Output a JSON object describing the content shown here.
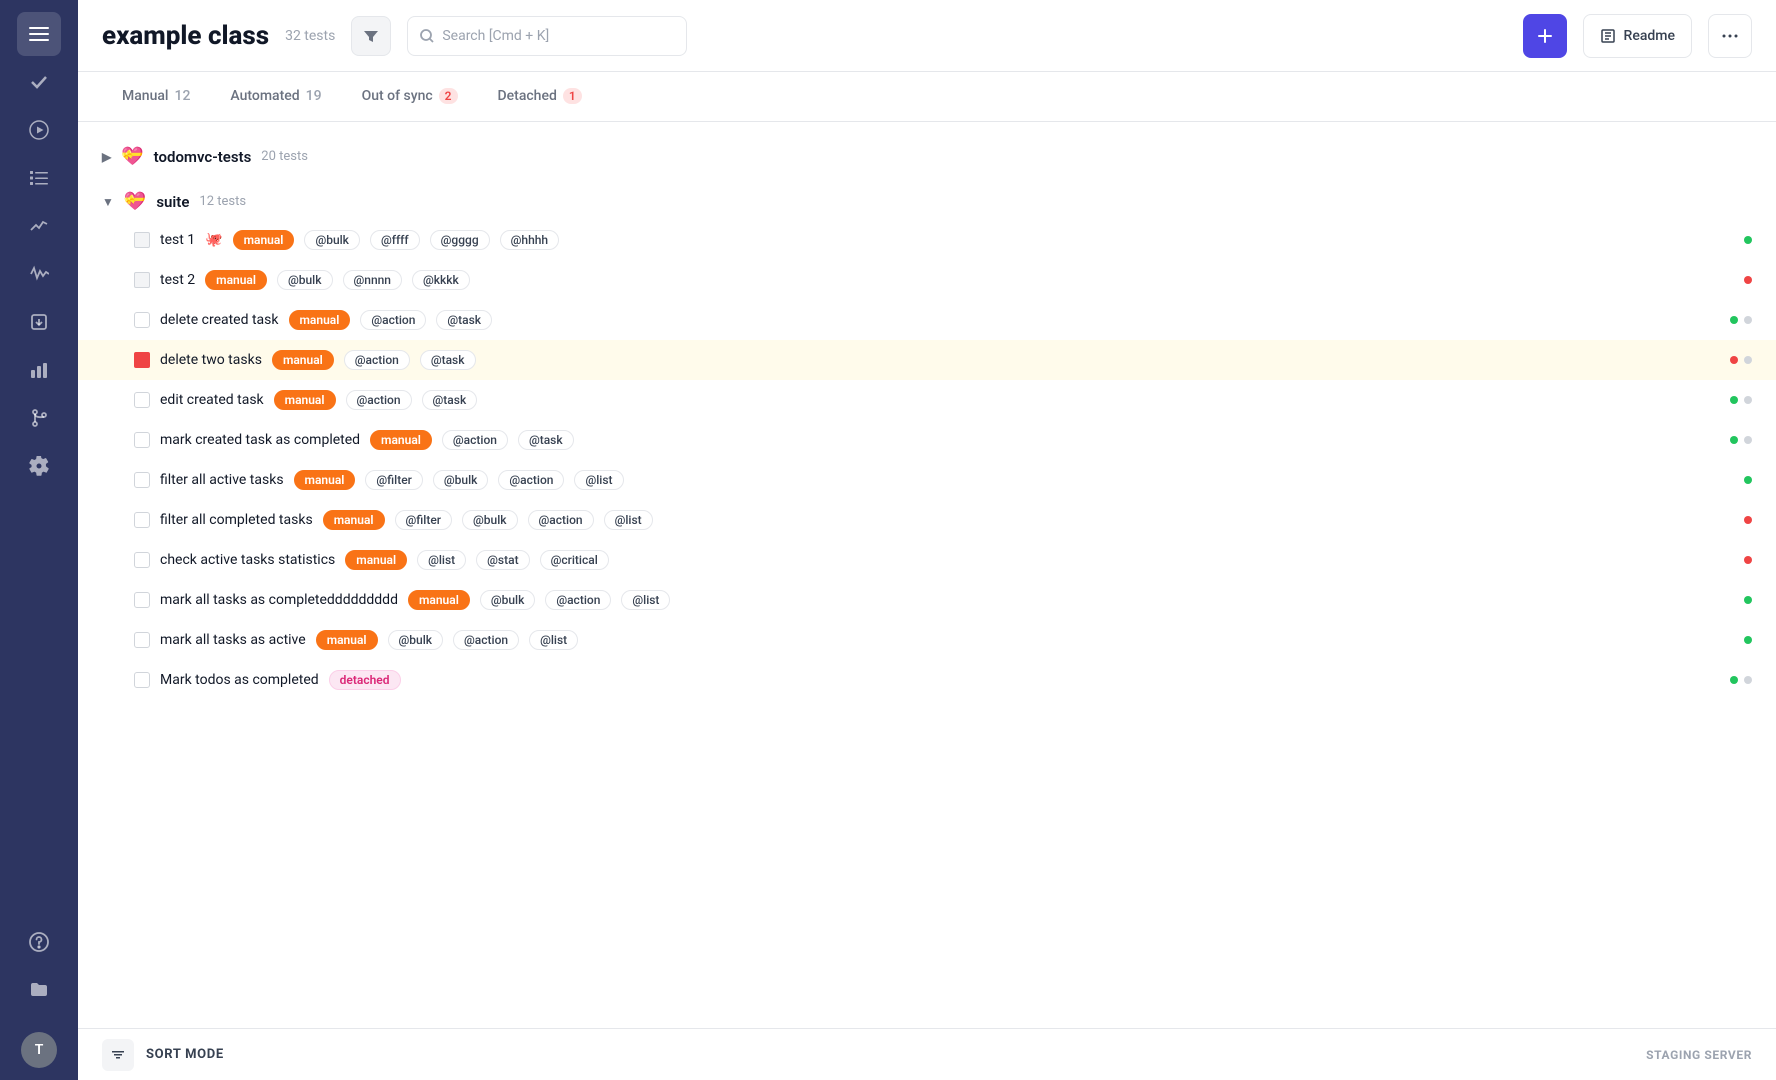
{
  "app": {
    "title": "example class",
    "test_count": "32 tests"
  },
  "sidebar": {
    "items": [
      {
        "name": "hamburger-menu-icon",
        "icon": "☰",
        "active": true
      },
      {
        "name": "check-icon",
        "icon": "✓",
        "active": false
      },
      {
        "name": "play-icon",
        "icon": "▶",
        "active": false
      },
      {
        "name": "checklist-icon",
        "icon": "≡",
        "active": false
      },
      {
        "name": "chart-line-icon",
        "icon": "⟋",
        "active": false
      },
      {
        "name": "activity-icon",
        "icon": "〜",
        "active": false
      },
      {
        "name": "import-icon",
        "icon": "⬇",
        "active": false
      },
      {
        "name": "bar-chart-icon",
        "icon": "▦",
        "active": false
      },
      {
        "name": "git-branch-icon",
        "icon": "⑂",
        "active": false
      },
      {
        "name": "settings-icon",
        "icon": "⚙",
        "active": false
      },
      {
        "name": "help-icon",
        "icon": "?",
        "active": false
      },
      {
        "name": "folder-icon",
        "icon": "🗂",
        "active": false
      }
    ],
    "avatar": "T"
  },
  "header": {
    "filter_label": "🔽",
    "search_placeholder": "Search [Cmd + K]",
    "add_label": "+",
    "readme_label": "Readme",
    "more_label": "···"
  },
  "tabs": [
    {
      "label": "Manual",
      "count": "12",
      "badge": false,
      "active": false
    },
    {
      "label": "Automated",
      "count": "19",
      "badge": false,
      "active": false
    },
    {
      "label": "Out of sync",
      "count": "2",
      "badge": true,
      "badge_color": "red",
      "active": false
    },
    {
      "label": "Detached",
      "count": "1",
      "badge": true,
      "badge_color": "red",
      "active": false
    }
  ],
  "suites": [
    {
      "name": "todomvc-tests",
      "emoji": "💝",
      "count": "20 tests",
      "collapsed": true,
      "toggle": "▶"
    },
    {
      "name": "suite",
      "emoji": "💝",
      "count": "12 tests",
      "collapsed": false,
      "toggle": "▼",
      "tests": [
        {
          "name": "test 1",
          "emoji": "🐙",
          "icon_type": "square",
          "tags": [
            {
              "label": "manual",
              "type": "manual"
            },
            {
              "label": "@bulk",
              "type": "default"
            },
            {
              "label": "@ffff",
              "type": "default"
            },
            {
              "label": "@gggg",
              "type": "default"
            },
            {
              "label": "@hhhh",
              "type": "default"
            }
          ],
          "dots": [
            "green"
          ]
        },
        {
          "name": "test 2",
          "emoji": "",
          "icon_type": "square",
          "tags": [
            {
              "label": "manual",
              "type": "manual"
            },
            {
              "label": "@bulk",
              "type": "default"
            },
            {
              "label": "@nnnn",
              "type": "default"
            },
            {
              "label": "@kkkk",
              "type": "default"
            }
          ],
          "dots": [
            "red"
          ]
        },
        {
          "name": "delete created task",
          "emoji": "",
          "icon_type": "checkbox",
          "tags": [
            {
              "label": "manual",
              "type": "manual"
            },
            {
              "label": "@action",
              "type": "default"
            },
            {
              "label": "@task",
              "type": "default"
            }
          ],
          "dots": [
            "green",
            "gray"
          ]
        },
        {
          "name": "delete two tasks",
          "emoji": "",
          "icon_type": "red",
          "highlighted": true,
          "tags": [
            {
              "label": "manual",
              "type": "manual"
            },
            {
              "label": "@action",
              "type": "default"
            },
            {
              "label": "@task",
              "type": "default"
            }
          ],
          "dots": [
            "red",
            "gray"
          ]
        },
        {
          "name": "edit created task",
          "emoji": "",
          "icon_type": "checkbox",
          "tags": [
            {
              "label": "manual",
              "type": "manual"
            },
            {
              "label": "@action",
              "type": "default"
            },
            {
              "label": "@task",
              "type": "default"
            }
          ],
          "dots": [
            "green",
            "gray"
          ]
        },
        {
          "name": "mark created task as completed",
          "emoji": "",
          "icon_type": "checkbox",
          "tags": [
            {
              "label": "manual",
              "type": "manual"
            },
            {
              "label": "@action",
              "type": "default"
            },
            {
              "label": "@task",
              "type": "default"
            }
          ],
          "dots": [
            "green",
            "gray"
          ]
        },
        {
          "name": "filter all active tasks",
          "emoji": "",
          "icon_type": "checkbox",
          "tags": [
            {
              "label": "manual",
              "type": "manual"
            },
            {
              "label": "@filter",
              "type": "default"
            },
            {
              "label": "@bulk",
              "type": "default"
            },
            {
              "label": "@action",
              "type": "default"
            },
            {
              "label": "@list",
              "type": "default"
            }
          ],
          "dots": [
            "green"
          ]
        },
        {
          "name": "filter all completed tasks",
          "emoji": "",
          "icon_type": "checkbox",
          "tags": [
            {
              "label": "manual",
              "type": "manual"
            },
            {
              "label": "@filter",
              "type": "default"
            },
            {
              "label": "@bulk",
              "type": "default"
            },
            {
              "label": "@action",
              "type": "default"
            },
            {
              "label": "@list",
              "type": "default"
            }
          ],
          "dots": [
            "red"
          ]
        },
        {
          "name": "check active tasks statistics",
          "emoji": "",
          "icon_type": "checkbox",
          "tags": [
            {
              "label": "manual",
              "type": "manual"
            },
            {
              "label": "@list",
              "type": "default"
            },
            {
              "label": "@stat",
              "type": "default"
            },
            {
              "label": "@critical",
              "type": "default"
            }
          ],
          "dots": [
            "red"
          ]
        },
        {
          "name": "mark all tasks as completeddddddddd",
          "emoji": "",
          "icon_type": "checkbox",
          "tags": [
            {
              "label": "manual",
              "type": "manual"
            },
            {
              "label": "@bulk",
              "type": "default"
            },
            {
              "label": "@action",
              "type": "default"
            },
            {
              "label": "@list",
              "type": "default"
            }
          ],
          "dots": [
            "green"
          ]
        },
        {
          "name": "mark all tasks as active",
          "emoji": "",
          "icon_type": "checkbox",
          "tags": [
            {
              "label": "manual",
              "type": "manual"
            },
            {
              "label": "@bulk",
              "type": "default"
            },
            {
              "label": "@action",
              "type": "default"
            },
            {
              "label": "@list",
              "type": "default"
            }
          ],
          "dots": [
            "green"
          ]
        },
        {
          "name": "Mark todos as completed",
          "emoji": "",
          "icon_type": "checkbox",
          "tags": [
            {
              "label": "detached",
              "type": "detached"
            }
          ],
          "dots": [
            "green",
            "gray"
          ]
        }
      ]
    }
  ],
  "bottom_bar": {
    "sort_mode_label": "SORT MODE",
    "staging_label": "STAGING SERVER"
  }
}
